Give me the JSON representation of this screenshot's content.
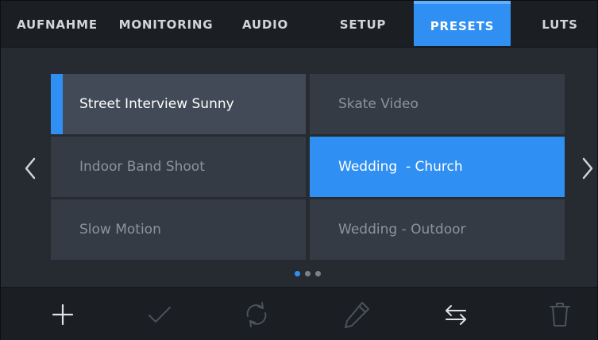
{
  "tabs": [
    {
      "label": "AUFNAHME",
      "active": false
    },
    {
      "label": "MONITORING",
      "active": false
    },
    {
      "label": "AUDIO",
      "active": false
    },
    {
      "label": "SETUP",
      "active": false
    },
    {
      "label": "PRESETS",
      "active": true
    },
    {
      "label": "LUTS",
      "active": false
    }
  ],
  "presets": [
    {
      "label": "Street Interview Sunny",
      "state": "current"
    },
    {
      "label": "Skate Video",
      "state": "normal"
    },
    {
      "label": "Indoor Band Shoot",
      "state": "normal"
    },
    {
      "label": "Wedding  - Church",
      "state": "selected"
    },
    {
      "label": "Slow Motion",
      "state": "normal"
    },
    {
      "label": "Wedding - Outdoor",
      "state": "normal"
    }
  ],
  "pagination": {
    "pages": 3,
    "current": 1
  },
  "navigation": {
    "prev_icon": "chevron-left-icon",
    "next_icon": "chevron-right-icon"
  },
  "toolbar": {
    "icons": [
      "add-icon",
      "check-icon",
      "refresh-icon",
      "pencil-icon",
      "swap-arrows-icon",
      "trash-icon"
    ]
  },
  "colors": {
    "accent": "#2f8ff2",
    "background": "#262b31",
    "bar": "#1b1e22",
    "cell": "#343b45",
    "cell_current": "#414a56"
  }
}
